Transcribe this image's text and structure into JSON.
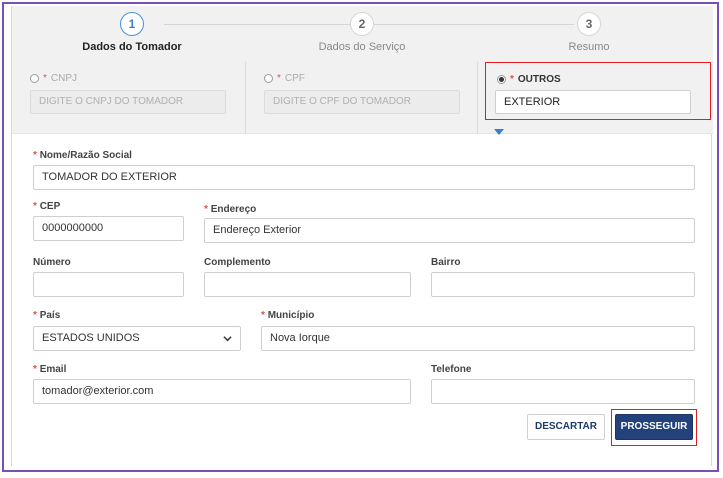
{
  "steps": [
    {
      "number": "1",
      "label": "Dados do Tomador",
      "active": true
    },
    {
      "number": "2",
      "label": "Dados do Serviço",
      "active": false
    },
    {
      "number": "3",
      "label": "Resumo",
      "active": false
    }
  ],
  "doc_types": {
    "cnpj": {
      "required_mark": "*",
      "label": "CNPJ",
      "placeholder": "DIGITE O CNPJ DO TOMADOR"
    },
    "cpf": {
      "required_mark": "*",
      "label": "CPF",
      "placeholder": "DIGITE O CPF DO TOMADOR"
    },
    "outros": {
      "required_mark": "*",
      "label": "OUTROS",
      "value": "EXTERIOR"
    }
  },
  "form": {
    "nome": {
      "required_mark": "*",
      "label": "Nome/Razão Social",
      "value": "TOMADOR DO EXTERIOR"
    },
    "cep": {
      "required_mark": "*",
      "label": "CEP",
      "value": "0000000000"
    },
    "endereco": {
      "required_mark": "*",
      "label": "Endereço",
      "value": "Endereço Exterior"
    },
    "numero": {
      "label": "Número",
      "value": ""
    },
    "complemento": {
      "label": "Complemento",
      "value": ""
    },
    "bairro": {
      "label": "Bairro",
      "value": ""
    },
    "pais": {
      "required_mark": "*",
      "label": "País",
      "value": "ESTADOS UNIDOS"
    },
    "municipio": {
      "required_mark": "*",
      "label": "Município",
      "value": "Nova Iorque"
    },
    "email": {
      "required_mark": "*",
      "label": "Email",
      "value": "tomador@exterior.com"
    },
    "telefone": {
      "label": "Telefone",
      "value": ""
    }
  },
  "actions": {
    "discard_label": "DESCARTAR",
    "next_label": "PROSSEGUIR"
  },
  "colors": {
    "accent": "#23417a",
    "highlight": "#e02020",
    "frame": "#7b4fb8",
    "required": "#d9534f"
  }
}
